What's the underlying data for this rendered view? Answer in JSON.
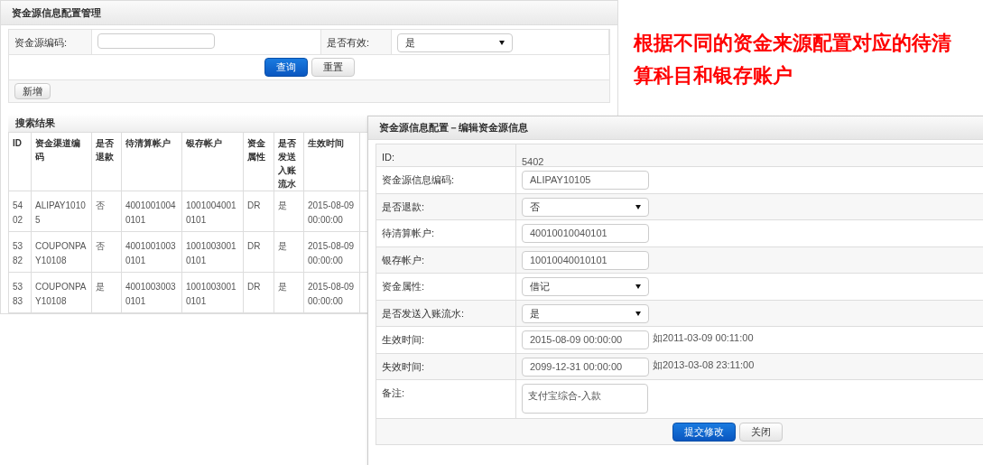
{
  "page": {
    "title": "资金源信息配置管理",
    "filters": [
      {
        "label": "资金源编码:",
        "kind": "text"
      },
      {
        "label": "是否有效:",
        "kind": "select",
        "value": "是"
      }
    ],
    "buttons": [
      {
        "label": "查询",
        "primary": true
      },
      {
        "label": "重置",
        "primary": false
      }
    ],
    "add_button": "新增",
    "results_title": "搜索结果",
    "table": {
      "columns": [
        "ID",
        "资金渠道编码",
        "是否退款",
        "待清算帐户",
        "银存帐户",
        "资金属性",
        "是否发送入账流水",
        "生效时间"
      ],
      "rows": [
        [
          "5402",
          "ALIPAY10105",
          "否",
          "40010010040101",
          "10010040010101",
          "DR",
          "是",
          "2015-08-09 00:00:00"
        ],
        [
          "5382",
          "COUPONPAY10108",
          "否",
          "40010010030101",
          "10010030010101",
          "DR",
          "是",
          "2015-08-09 00:00:00"
        ],
        [
          "5383",
          "COUPONPAY10108",
          "是",
          "40010030030101",
          "10010030010101",
          "DR",
          "是",
          "2015-08-09 00:00:00"
        ]
      ]
    }
  },
  "annotation": "根据不同的资金来源配置对应的待清算科目和银存账户",
  "dialog": {
    "title": "资金源信息配置－编辑资金源信息",
    "fields": [
      {
        "label": "ID:",
        "kind": "static",
        "value": "5402"
      },
      {
        "label": "资金源信息编码:",
        "kind": "text",
        "value": "ALIPAY10105"
      },
      {
        "label": "是否退款:",
        "kind": "select",
        "value": "否"
      },
      {
        "label": "待清算帐户:",
        "kind": "text",
        "value": "40010010040101"
      },
      {
        "label": "银存帐户:",
        "kind": "text",
        "value": "10010040010101"
      },
      {
        "label": "资金属性:",
        "kind": "select",
        "value": "借记"
      },
      {
        "label": "是否发送入账流水:",
        "kind": "select",
        "value": "是"
      },
      {
        "label": "生效时间:",
        "kind": "text",
        "value": "2015-08-09 00:00:00",
        "hint": "如2011-03-09 00:11:00"
      },
      {
        "label": "失效时间:",
        "kind": "text",
        "value": "2099-12-31 00:00:00",
        "hint": "如2013-03-08 23:11:00"
      },
      {
        "label": "备注:",
        "kind": "textarea",
        "value": "支付宝综合-入款"
      }
    ],
    "buttons": [
      {
        "label": "提交修改",
        "primary": true
      },
      {
        "label": "关闭",
        "primary": false
      }
    ]
  }
}
